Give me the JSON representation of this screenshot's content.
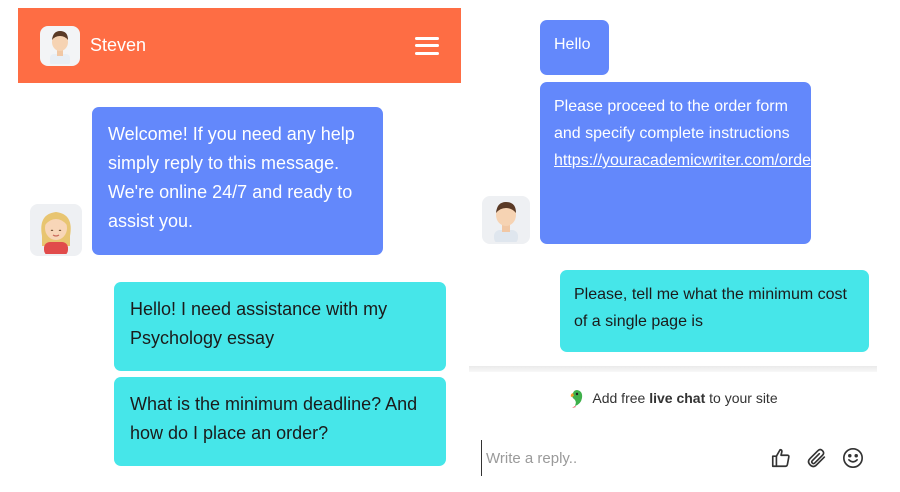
{
  "header": {
    "name": "Steven",
    "background_color": "#fe6d44"
  },
  "left_chat": {
    "agent_message": "Welcome! If you need any help simply reply to this message. We're online 24/7 and ready to assist you.",
    "user_messages": [
      "Hello! I need assistance with my Psychology essay",
      "What is the minimum deadline? And how do I place an order?"
    ]
  },
  "right_chat": {
    "agent_messages": [
      "Hello",
      "Please proceed to the order form and specify complete instructions"
    ],
    "agent_link": "https://youracademicwriter.com/order",
    "user_message": "Please, tell me what the minimum cost of a single page is"
  },
  "promo": {
    "prefix": "Add free ",
    "bold": "live chat",
    "suffix": " to your site"
  },
  "reply": {
    "placeholder": "Write a reply.."
  },
  "icons": {
    "menu": "hamburger-menu-icon",
    "like": "thumbs-up-icon",
    "attach": "paperclip-icon",
    "emoji": "smiley-icon"
  },
  "colors": {
    "agent_bubble": "#6388fb",
    "user_bubble": "#46e6e9"
  }
}
